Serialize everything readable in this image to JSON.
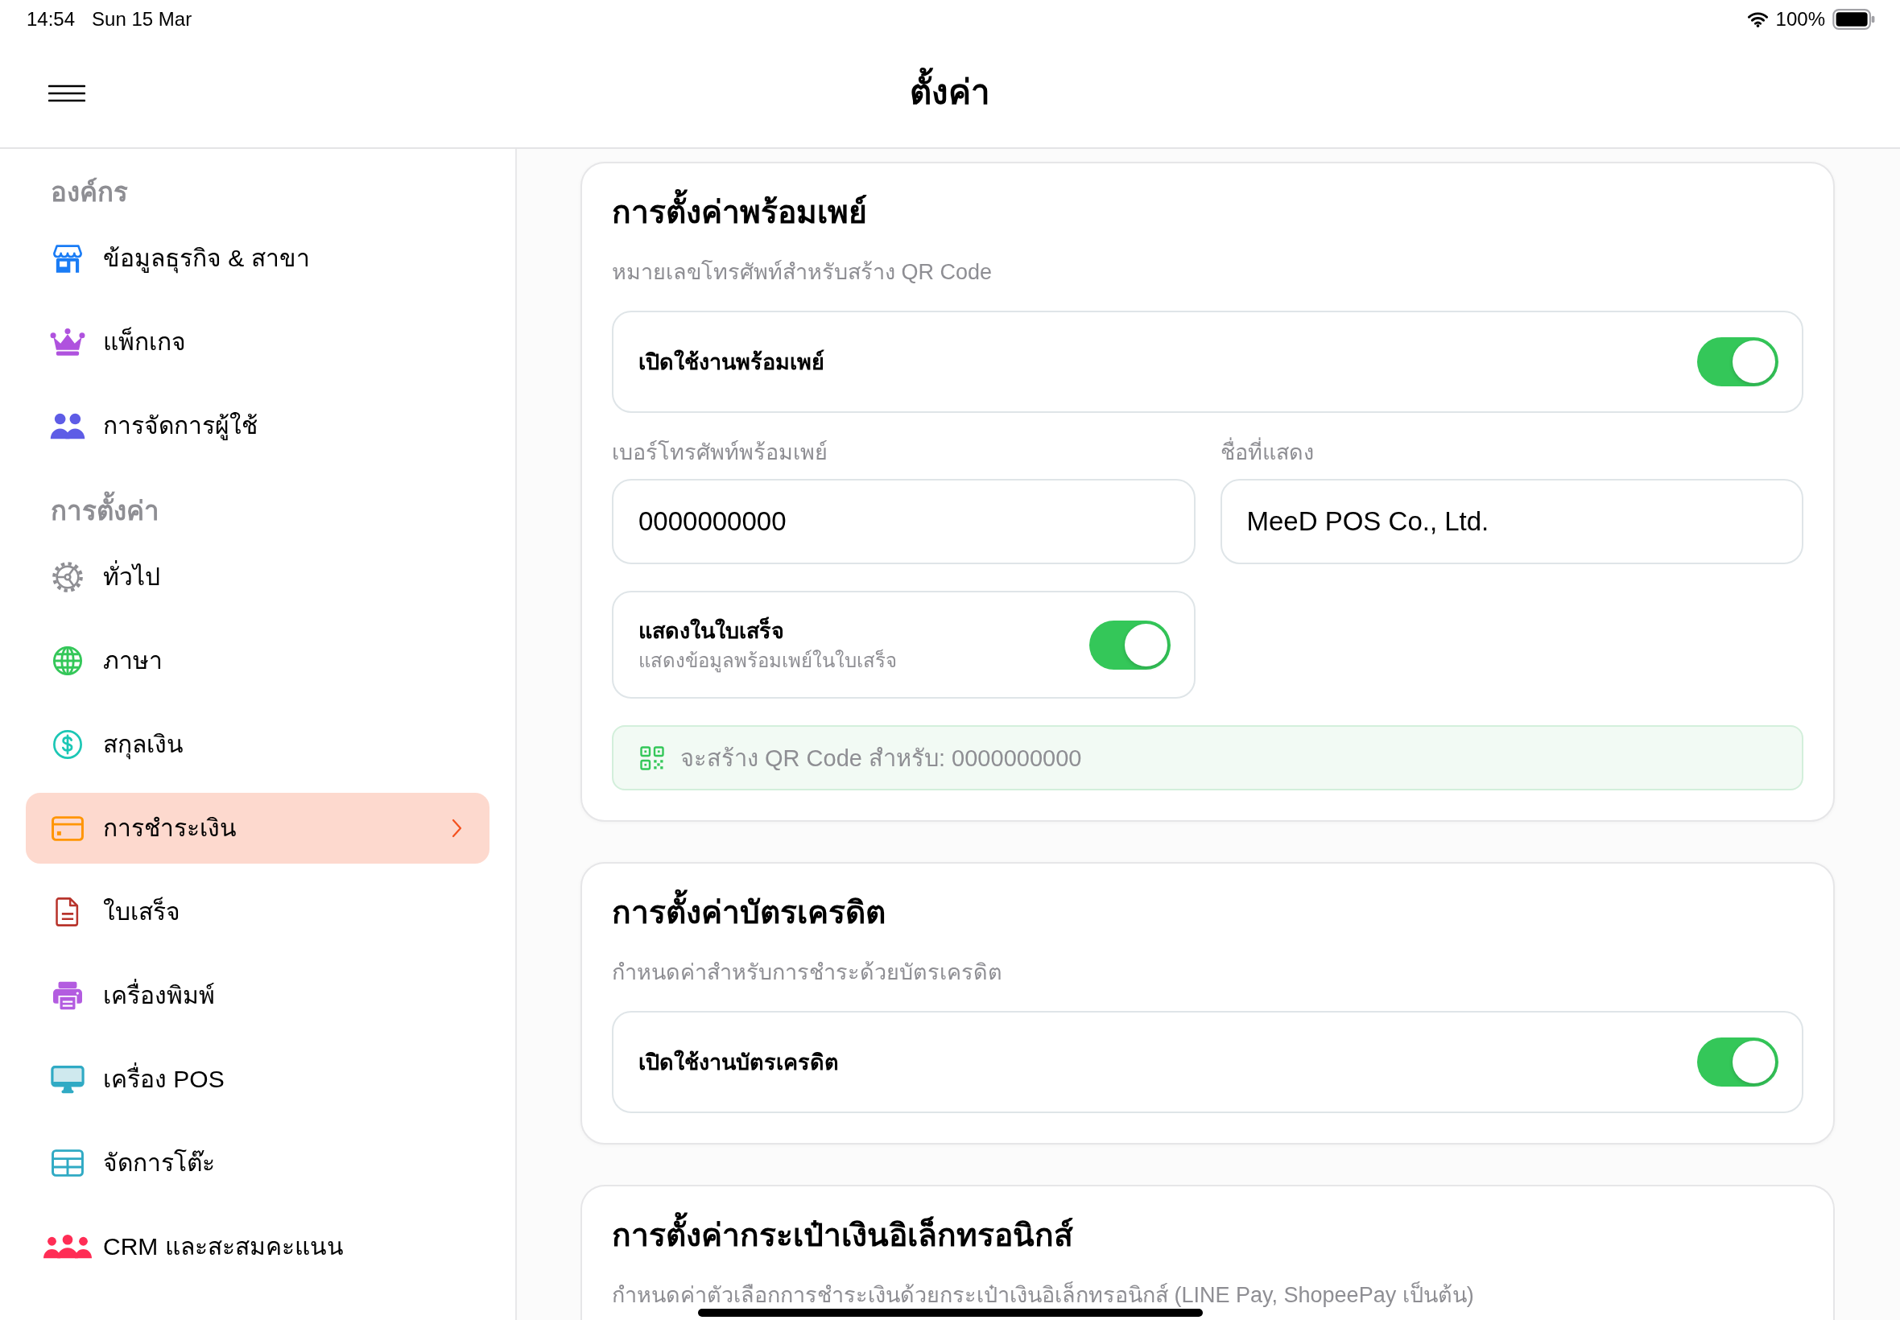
{
  "status_bar": {
    "time": "14:54",
    "date": "Sun 15 Mar",
    "battery": "100%"
  },
  "header": {
    "title": "ตั้งค่า"
  },
  "sidebar": {
    "sections": [
      {
        "title": "องค์กร",
        "items": [
          {
            "label": "ข้อมูลธุรกิจ & สาขา",
            "selected": false
          },
          {
            "label": "แพ็กเกจ",
            "selected": false
          },
          {
            "label": "การจัดการผู้ใช้",
            "selected": false
          }
        ]
      },
      {
        "title": "การตั้งค่า",
        "items": [
          {
            "label": "ทั่วไป",
            "selected": false
          },
          {
            "label": "ภาษา",
            "selected": false
          },
          {
            "label": "สกุลเงิน",
            "selected": false
          },
          {
            "label": "การชำระเงิน",
            "selected": true
          },
          {
            "label": "ใบเสร็จ",
            "selected": false
          },
          {
            "label": "เครื่องพิมพ์",
            "selected": false
          },
          {
            "label": "เครื่อง POS",
            "selected": false
          },
          {
            "label": "จัดการโต๊ะ",
            "selected": false
          },
          {
            "label": "CRM และสะสมคะแนน",
            "selected": false
          }
        ]
      }
    ]
  },
  "cards": [
    {
      "title": "การตั้งค่าพร้อมเพย์",
      "subtitle": "หมายเลขโทรศัพท์สำหรับสร้าง QR Code",
      "rows": [
        {
          "kind": "toggle",
          "label": "เปิดใช้งานพร้อมเพย์",
          "on": true
        },
        {
          "kind": "fields",
          "fields": [
            {
              "label": "เบอร์โทรศัพท์พร้อมเพย์",
              "value": "0000000000"
            },
            {
              "label": "ชื่อที่แสดง",
              "value": "MeeD POS Co., Ltd."
            }
          ]
        },
        {
          "kind": "option",
          "label": "แสดงในใบเสร็จ",
          "description": "แสดงข้อมูลพร้อมเพย์ในใบเสร็จ",
          "on": true
        },
        {
          "kind": "note",
          "text": "จะสร้าง QR Code สำหรับ: 0000000000"
        }
      ]
    },
    {
      "title": "การตั้งค่าบัตรเครดิต",
      "subtitle": "กำหนดค่าสำหรับการชำระด้วยบัตรเครดิต",
      "rows": [
        {
          "kind": "toggle",
          "label": "เปิดใช้งานบัตรเครดิต",
          "on": true
        }
      ]
    },
    {
      "title": "การตั้งค่ากระเป๋าเงินอิเล็กทรอนิกส์",
      "subtitle": "กำหนดค่าตัวเลือกการชำระเงินด้วยกระเป๋าเงินอิเล็กทรอนิกส์ (LINE Pay, ShopeePay เป็นต้น)"
    }
  ]
}
